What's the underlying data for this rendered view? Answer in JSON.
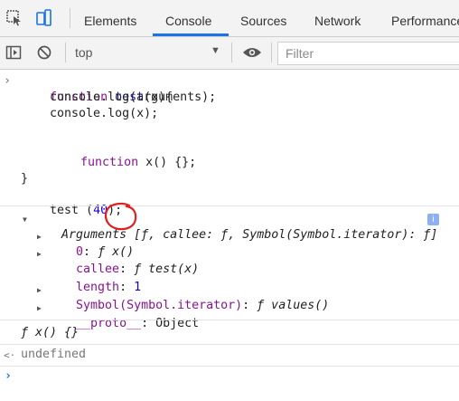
{
  "tabs": [
    {
      "label": "Elements"
    },
    {
      "label": "Console"
    },
    {
      "label": "Sources"
    },
    {
      "label": "Network"
    },
    {
      "label": "Performance"
    }
  ],
  "toolbar": {
    "context": "top",
    "filter_placeholder": "Filter"
  },
  "code": {
    "l1_kw": "function",
    "l1_name": "test",
    "l1_rest": "(x){",
    "l2": "    console.log(arguments);",
    "l3": "    console.log(x);",
    "l4_kw": "function",
    "l4_rest": "x() {};",
    "l5": "}",
    "l6_a": "test (",
    "l6_num": "40",
    "l6_b": ");"
  },
  "output": {
    "args_label": "Arguments",
    "args_summary_a": "[",
    "args_summary_f": "ƒ,",
    "args_summary_b": " callee: ƒ, Symbol(Symbol.iterator): ƒ]",
    "info": "i",
    "item0_key": "0",
    "item0_val": "ƒ x()",
    "callee_key": "callee",
    "callee_val": "ƒ test(x)",
    "length_key": "length",
    "length_val": "1",
    "symbol_key": "Symbol(Symbol.iterator)",
    "symbol_val": "ƒ values()",
    "proto_key": "__proto__",
    "proto_val": "Object",
    "log_x": "ƒ x() {}",
    "undefined": "undefined"
  },
  "colors": {
    "accent": "#1a73e8",
    "annotation": "#e02020"
  }
}
